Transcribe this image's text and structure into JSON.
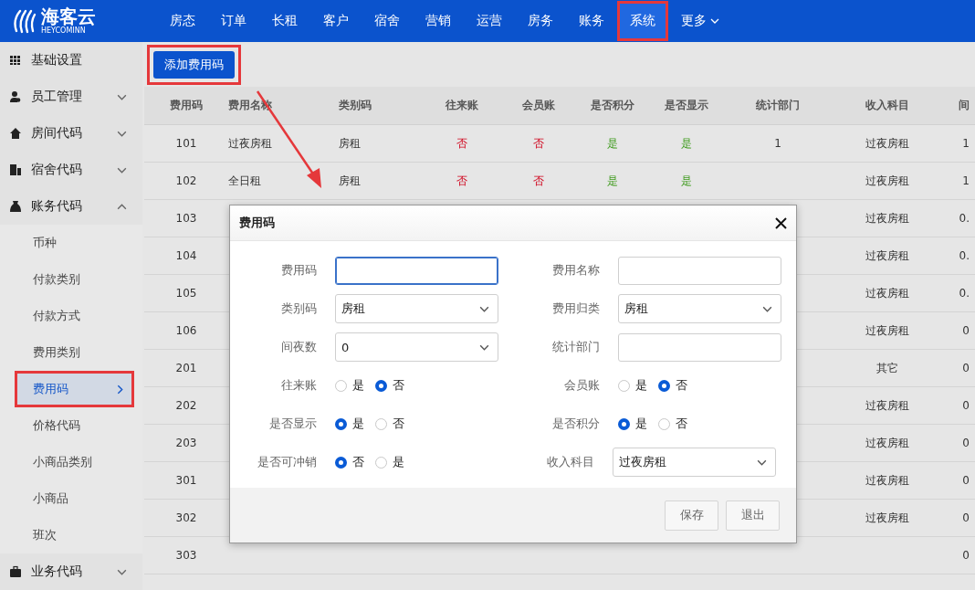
{
  "brand": {
    "name": "海客云",
    "sub": "HEYCOMINN"
  },
  "nav": [
    {
      "label": "房态",
      "selected": false,
      "annotated": false
    },
    {
      "label": "订单",
      "selected": false,
      "annotated": false
    },
    {
      "label": "长租",
      "selected": false,
      "annotated": false
    },
    {
      "label": "客户",
      "selected": false,
      "annotated": false
    },
    {
      "label": "宿舍",
      "selected": false,
      "annotated": false
    },
    {
      "label": "营销",
      "selected": false,
      "annotated": false
    },
    {
      "label": "运营",
      "selected": false,
      "annotated": false
    },
    {
      "label": "房务",
      "selected": false,
      "annotated": false
    },
    {
      "label": "账务",
      "selected": false,
      "annotated": false
    },
    {
      "label": "系统",
      "selected": true,
      "annotated": true
    },
    {
      "label": "更多",
      "selected": false,
      "annotated": false,
      "kind": "menu"
    }
  ],
  "sidebar": {
    "items": [
      {
        "label": "基础设置",
        "expandable": false
      },
      {
        "label": "员工管理",
        "expanded": false,
        "expandable": true
      },
      {
        "label": "房间代码",
        "expanded": false,
        "expandable": true
      },
      {
        "label": "宿舍代码",
        "expanded": false,
        "expandable": true
      },
      {
        "label": "账务代码",
        "expanded": true,
        "expandable": true,
        "children": [
          {
            "label": "币种",
            "selected": false,
            "annotated": false
          },
          {
            "label": "付款类别",
            "selected": false,
            "annotated": false
          },
          {
            "label": "付款方式",
            "selected": false,
            "annotated": false
          },
          {
            "label": "费用类别",
            "selected": false,
            "annotated": false
          },
          {
            "label": "费用码",
            "selected": true,
            "annotated": true
          },
          {
            "label": "价格代码",
            "selected": false,
            "annotated": false
          },
          {
            "label": "小商品类别",
            "selected": false,
            "annotated": false
          },
          {
            "label": "小商品",
            "selected": false,
            "annotated": false
          },
          {
            "label": "班次",
            "selected": false,
            "annotated": false
          }
        ]
      },
      {
        "label": "业务代码",
        "expanded": false,
        "expandable": true
      }
    ]
  },
  "toolbar": {
    "add_button": {
      "label": "添加费用码",
      "annotated": true
    }
  },
  "table": {
    "columns": [
      "费用码",
      "费用名称",
      "类别码",
      "往来账",
      "会员账",
      "是否积分",
      "是否显示",
      "统计部门",
      "收入科目",
      "间"
    ],
    "rows": [
      {
        "code": "101",
        "name": "过夜房租",
        "category": "房租",
        "ar": {
          "text": "否",
          "positive": false
        },
        "member": {
          "text": "否",
          "positive": false
        },
        "points": {
          "text": "是",
          "positive": true
        },
        "show": {
          "text": "是",
          "positive": true
        },
        "dept": "1",
        "income": "过夜房租",
        "nights": "1"
      },
      {
        "code": "102",
        "name": "全日租",
        "category": "房租",
        "ar": {
          "text": "否",
          "positive": false
        },
        "member": {
          "text": "否",
          "positive": false
        },
        "points": {
          "text": "是",
          "positive": true
        },
        "show": {
          "text": "是",
          "positive": true
        },
        "income": "过夜房租",
        "nights": "1"
      },
      {
        "code": "103",
        "income": "过夜房租",
        "nights": "0."
      },
      {
        "code": "104",
        "income": "过夜房租",
        "nights": "0."
      },
      {
        "code": "105",
        "income": "过夜房租",
        "nights": "0."
      },
      {
        "code": "106",
        "income": "过夜房租",
        "nights": "0"
      },
      {
        "code": "201",
        "income": "其它",
        "nights": "0"
      },
      {
        "code": "202",
        "income": "过夜房租",
        "nights": "0"
      },
      {
        "code": "203",
        "income": "过夜房租",
        "nights": "0"
      },
      {
        "code": "301",
        "income": "过夜房租",
        "nights": "0"
      },
      {
        "code": "302",
        "income": "过夜房租",
        "nights": "0"
      },
      {
        "code": "303",
        "nights": "0"
      }
    ]
  },
  "dialog": {
    "title": "费用码",
    "rows": [
      [
        {
          "label": "费用码",
          "kind": "input",
          "focused": true
        },
        {
          "label": "费用名称",
          "kind": "input",
          "focused": false
        }
      ],
      [
        {
          "label": "类别码",
          "kind": "select",
          "value": "房租"
        },
        {
          "label": "费用归类",
          "kind": "select",
          "value": "房租"
        }
      ],
      [
        {
          "label": "间夜数",
          "kind": "select",
          "value": "0"
        },
        {
          "label": "统计部门",
          "kind": "input",
          "focused": false
        }
      ],
      [
        {
          "label": "往来账",
          "kind": "radio",
          "options": [
            {
              "label": "是",
              "selected": false
            },
            {
              "label": "否",
              "selected": true
            }
          ]
        },
        {
          "label": "会员账",
          "kind": "radio",
          "options": [
            {
              "label": "是",
              "selected": false
            },
            {
              "label": "否",
              "selected": true
            }
          ]
        }
      ],
      [
        {
          "label": "是否显示",
          "kind": "radio",
          "options": [
            {
              "label": "是",
              "selected": true
            },
            {
              "label": "否",
              "selected": false
            }
          ]
        },
        {
          "label": "是否积分",
          "kind": "radio",
          "options": [
            {
              "label": "是",
              "selected": true
            },
            {
              "label": "否",
              "selected": false
            }
          ]
        }
      ],
      [
        {
          "label": "是否可冲销",
          "kind": "radio",
          "options": [
            {
              "label": "否",
              "selected": true
            },
            {
              "label": "是",
              "selected": false
            }
          ]
        },
        {
          "label": "收入科目",
          "kind": "select",
          "value": "过夜房租"
        }
      ]
    ],
    "buttons": [
      "保存",
      "退出"
    ]
  }
}
